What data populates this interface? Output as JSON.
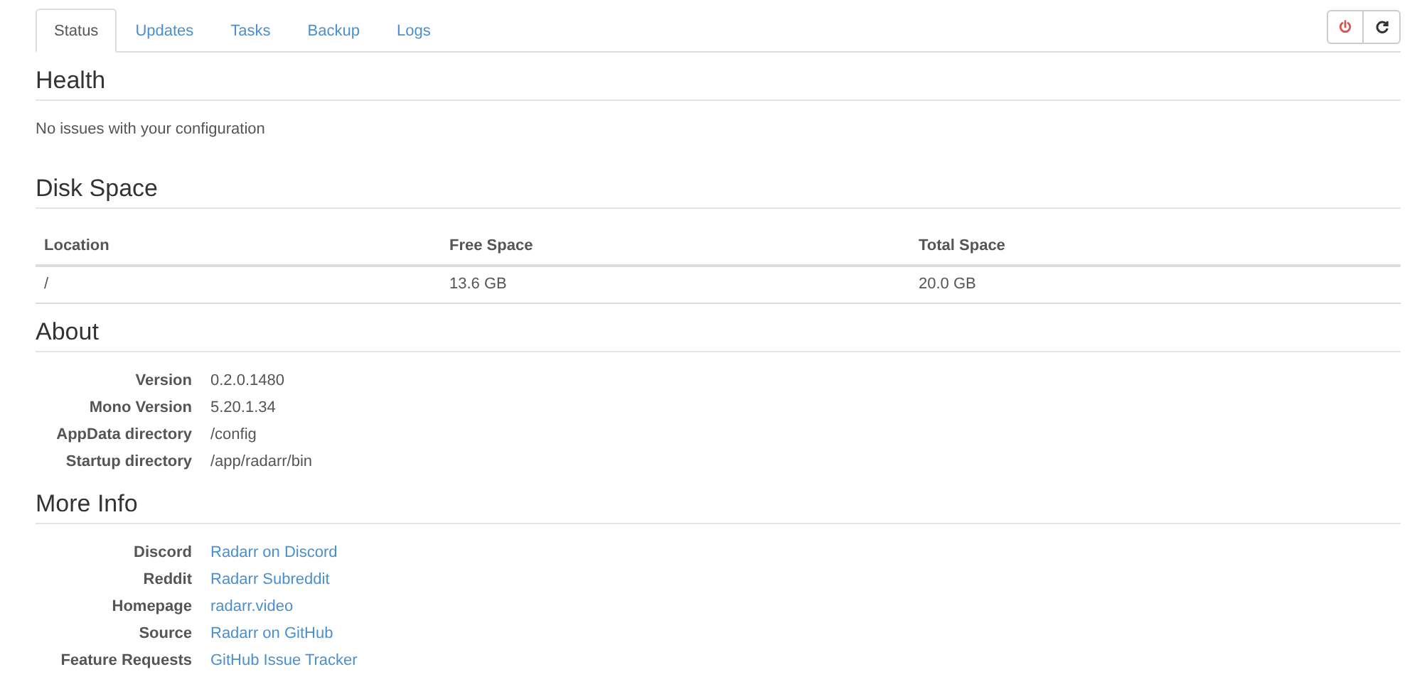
{
  "tabs": [
    {
      "label": "Status",
      "selected": true
    },
    {
      "label": "Updates",
      "selected": false
    },
    {
      "label": "Tasks",
      "selected": false
    },
    {
      "label": "Backup",
      "selected": false
    },
    {
      "label": "Logs",
      "selected": false
    }
  ],
  "health": {
    "title": "Health",
    "message": "No issues with your configuration"
  },
  "disk_space": {
    "title": "Disk Space",
    "columns": [
      "Location",
      "Free Space",
      "Total Space"
    ],
    "rows": [
      [
        "/",
        "13.6 GB",
        "20.0 GB"
      ]
    ]
  },
  "about": {
    "title": "About",
    "items": [
      {
        "label": "Version",
        "value": "0.2.0.1480"
      },
      {
        "label": "Mono Version",
        "value": "5.20.1.34"
      },
      {
        "label": "AppData directory",
        "value": "/config"
      },
      {
        "label": "Startup directory",
        "value": "/app/radarr/bin"
      }
    ]
  },
  "more_info": {
    "title": "More Info",
    "items": [
      {
        "label": "Discord",
        "value": "Radarr on Discord"
      },
      {
        "label": "Reddit",
        "value": "Radarr Subreddit"
      },
      {
        "label": "Homepage",
        "value": "radarr.video"
      },
      {
        "label": "Source",
        "value": "Radarr on GitHub"
      },
      {
        "label": "Feature Requests",
        "value": "GitHub Issue Tracker"
      }
    ]
  }
}
